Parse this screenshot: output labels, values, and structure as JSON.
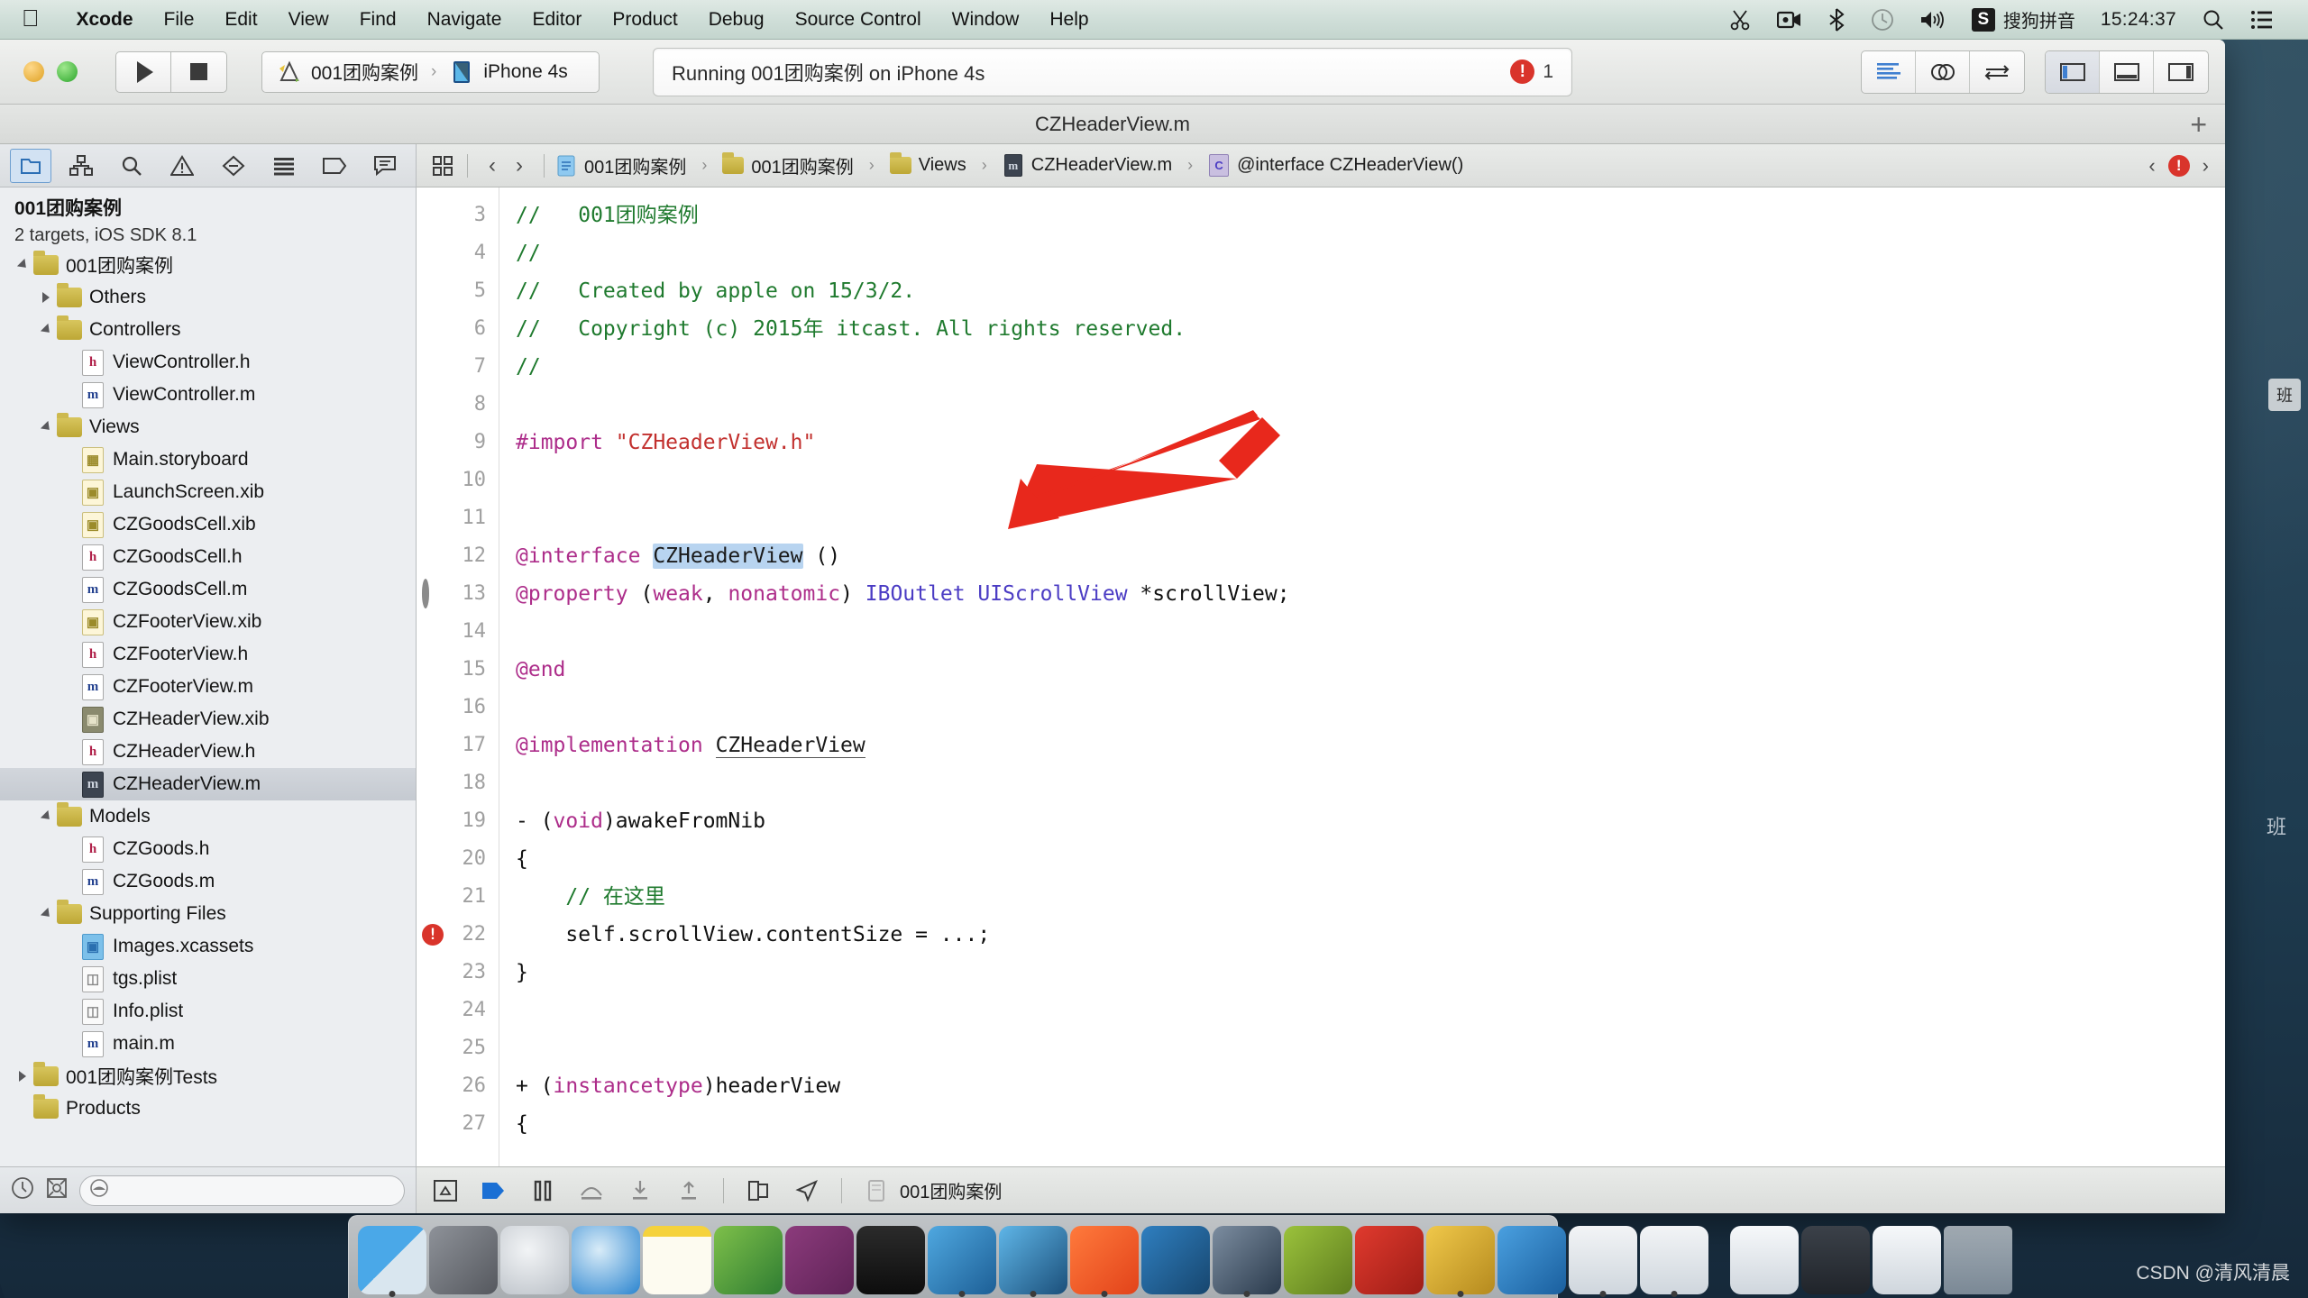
{
  "menubar": {
    "apple_icon": "apple-logo-icon",
    "items": [
      {
        "label": "Xcode",
        "bold": true
      },
      {
        "label": "File",
        "bold": false
      },
      {
        "label": "Edit",
        "bold": false
      },
      {
        "label": "View",
        "bold": false
      },
      {
        "label": "Find",
        "bold": false
      },
      {
        "label": "Navigate",
        "bold": false
      },
      {
        "label": "Editor",
        "bold": false
      },
      {
        "label": "Product",
        "bold": false
      },
      {
        "label": "Debug",
        "bold": false
      },
      {
        "label": "Source Control",
        "bold": false
      },
      {
        "label": "Window",
        "bold": false
      },
      {
        "label": "Help",
        "bold": false
      }
    ],
    "status": {
      "scissors_icon": "scissors-icon",
      "screen_record_icon": "screen-record-icon",
      "bluetooth_icon": "bluetooth-icon",
      "time_machine_icon": "time-machine-icon",
      "volume_icon": "volume-icon",
      "input_badge": "S",
      "input_name": "搜狗拼音",
      "clock": "15:24:37",
      "spotlight_icon": "search-icon",
      "notification_icon": "notification-center-icon"
    }
  },
  "toolbar": {
    "run_icon": "run-play-icon",
    "stop_icon": "stop-square-icon",
    "scheme_project": "001团购案例",
    "scheme_separator": "›",
    "scheme_destination": "iPhone 4s",
    "activity_status": "Running 001团购案例 on iPhone 4s",
    "issue_badge_icon": "error-icon",
    "issue_count": "1",
    "editor_modes": [
      {
        "name": "standard-editor",
        "icon": "lines-icon",
        "active": false
      },
      {
        "name": "assistant-editor",
        "icon": "venn-circles-icon",
        "active": false
      },
      {
        "name": "version-editor",
        "icon": "swap-arrows-icon",
        "active": false
      }
    ],
    "view_toggles": [
      {
        "name": "toggle-navigator",
        "icon": "left-panel-icon",
        "active": true
      },
      {
        "name": "toggle-debug-area",
        "icon": "bottom-panel-icon",
        "active": false
      },
      {
        "name": "toggle-utilities",
        "icon": "right-panel-icon",
        "active": false
      }
    ]
  },
  "window": {
    "title": "CZHeaderView.m",
    "add_tab_icon": "plus-icon"
  },
  "navigator": {
    "tabs": [
      {
        "name": "project-navigator",
        "icon": "folder-navigator-icon",
        "active": true
      },
      {
        "name": "symbol-navigator",
        "icon": "symbol-navigator-icon",
        "active": false
      },
      {
        "name": "find-navigator",
        "icon": "search-icon",
        "active": false
      },
      {
        "name": "issue-navigator",
        "icon": "warning-triangle-icon",
        "active": false
      },
      {
        "name": "test-navigator",
        "icon": "test-diamond-icon",
        "active": false
      },
      {
        "name": "debug-navigator",
        "icon": "debug-bars-icon",
        "active": false
      },
      {
        "name": "breakpoint-navigator",
        "icon": "breakpoint-tag-icon",
        "active": false
      },
      {
        "name": "report-navigator",
        "icon": "report-bubble-icon",
        "active": false
      }
    ],
    "project_name": "001团购案例",
    "project_subtitle": "2 targets, iOS SDK 8.1",
    "tree": [
      {
        "label": "001团购案例",
        "type": "folder",
        "indent": 0,
        "disclosure": "open",
        "selected": false
      },
      {
        "label": "Others",
        "type": "folder",
        "indent": 1,
        "disclosure": "closed",
        "selected": false
      },
      {
        "label": "Controllers",
        "type": "folder",
        "indent": 1,
        "disclosure": "open",
        "selected": false
      },
      {
        "label": "ViewController.h",
        "type": "h",
        "indent": 2,
        "disclosure": "none",
        "selected": false
      },
      {
        "label": "ViewController.m",
        "type": "m",
        "indent": 2,
        "disclosure": "none",
        "selected": false
      },
      {
        "label": "Views",
        "type": "folder",
        "indent": 1,
        "disclosure": "open",
        "selected": false
      },
      {
        "label": "Main.storyboard",
        "type": "sb",
        "indent": 2,
        "disclosure": "none",
        "selected": false
      },
      {
        "label": "LaunchScreen.xib",
        "type": "xib",
        "indent": 2,
        "disclosure": "none",
        "selected": false
      },
      {
        "label": "CZGoodsCell.xib",
        "type": "xib",
        "indent": 2,
        "disclosure": "none",
        "selected": false
      },
      {
        "label": "CZGoodsCell.h",
        "type": "h",
        "indent": 2,
        "disclosure": "none",
        "selected": false
      },
      {
        "label": "CZGoodsCell.m",
        "type": "m",
        "indent": 2,
        "disclosure": "none",
        "selected": false
      },
      {
        "label": "CZFooterView.xib",
        "type": "xib",
        "indent": 2,
        "disclosure": "none",
        "selected": false
      },
      {
        "label": "CZFooterView.h",
        "type": "h",
        "indent": 2,
        "disclosure": "none",
        "selected": false
      },
      {
        "label": "CZFooterView.m",
        "type": "m",
        "indent": 2,
        "disclosure": "none",
        "selected": false
      },
      {
        "label": "CZHeaderView.xib",
        "type": "xibdark",
        "indent": 2,
        "disclosure": "none",
        "selected": false
      },
      {
        "label": "CZHeaderView.h",
        "type": "h",
        "indent": 2,
        "disclosure": "none",
        "selected": false
      },
      {
        "label": "CZHeaderView.m",
        "type": "mdark",
        "indent": 2,
        "disclosure": "none",
        "selected": true
      },
      {
        "label": "Models",
        "type": "folder",
        "indent": 1,
        "disclosure": "open",
        "selected": false
      },
      {
        "label": "CZGoods.h",
        "type": "h",
        "indent": 2,
        "disclosure": "none",
        "selected": false
      },
      {
        "label": "CZGoods.m",
        "type": "m",
        "indent": 2,
        "disclosure": "none",
        "selected": false
      },
      {
        "label": "Supporting Files",
        "type": "folder",
        "indent": 1,
        "disclosure": "open",
        "selected": false
      },
      {
        "label": "Images.xcassets",
        "type": "xcassets",
        "indent": 2,
        "disclosure": "none",
        "selected": false
      },
      {
        "label": "tgs.plist",
        "type": "plist",
        "indent": 2,
        "disclosure": "none",
        "selected": false
      },
      {
        "label": "Info.plist",
        "type": "plist",
        "indent": 2,
        "disclosure": "none",
        "selected": false
      },
      {
        "label": "main.m",
        "type": "m",
        "indent": 2,
        "disclosure": "none",
        "selected": false
      },
      {
        "label": "001团购案例Tests",
        "type": "folder",
        "indent": 0,
        "disclosure": "closed",
        "selected": false
      },
      {
        "label": "Products",
        "type": "folder",
        "indent": 0,
        "disclosure": "none",
        "selected": false
      }
    ],
    "bottom": {
      "recent_icon": "clock-icon",
      "source_control_icon": "source-control-icon",
      "filter_icon": "filter-icon",
      "filter_placeholder": ""
    }
  },
  "jumpbar": {
    "related_icon": "related-items-icon",
    "back_icon": "chevron-left-icon",
    "forward_icon": "chevron-right-icon",
    "crumbs": [
      {
        "label": "001团购案例",
        "icon": "project-icon"
      },
      {
        "label": "001团购案例",
        "icon": "folder-icon"
      },
      {
        "label": "Views",
        "icon": "folder-icon"
      },
      {
        "label": "CZHeaderView.m",
        "icon": "m-file-icon"
      },
      {
        "label": "@interface CZHeaderView()",
        "icon": "interface-icon"
      }
    ],
    "prev_issue_icon": "chevron-left-icon",
    "issue_badge": "error-icon",
    "next_issue_icon": "chevron-right-icon"
  },
  "code": {
    "lines": [
      {
        "n": "3",
        "marker": "none",
        "tokens": [
          {
            "t": "//   001团购案例",
            "c": "cmt"
          }
        ]
      },
      {
        "n": "4",
        "marker": "none",
        "tokens": [
          {
            "t": "//",
            "c": "cmt"
          }
        ]
      },
      {
        "n": "5",
        "marker": "none",
        "tokens": [
          {
            "t": "//   Created by apple on 15/3/2.",
            "c": "cmt"
          }
        ]
      },
      {
        "n": "6",
        "marker": "none",
        "tokens": [
          {
            "t": "//   Copyright (c) 2015年 itcast. All rights reserved.",
            "c": "cmt"
          }
        ]
      },
      {
        "n": "7",
        "marker": "none",
        "tokens": [
          {
            "t": "//",
            "c": "cmt"
          }
        ]
      },
      {
        "n": "8",
        "marker": "none",
        "tokens": []
      },
      {
        "n": "9",
        "marker": "none",
        "tokens": [
          {
            "t": "#import ",
            "c": "pre"
          },
          {
            "t": "\"CZHeaderView.h\"",
            "c": "str"
          }
        ]
      },
      {
        "n": "10",
        "marker": "none",
        "tokens": []
      },
      {
        "n": "11",
        "marker": "none",
        "tokens": []
      },
      {
        "n": "12",
        "marker": "none",
        "tokens": [
          {
            "t": "@interface ",
            "c": "kw"
          },
          {
            "t": "CZHeaderView",
            "c": "sel"
          },
          {
            "t": " ()",
            "c": "id"
          }
        ]
      },
      {
        "n": "13",
        "marker": "dot",
        "tokens": [
          {
            "t": "@property ",
            "c": "kw"
          },
          {
            "t": "(",
            "c": "id"
          },
          {
            "t": "weak",
            "c": "kw"
          },
          {
            "t": ", ",
            "c": "id"
          },
          {
            "t": "nonatomic",
            "c": "kw"
          },
          {
            "t": ") ",
            "c": "id"
          },
          {
            "t": "IBOutlet ",
            "c": "typ"
          },
          {
            "t": "UIScrollView ",
            "c": "typ"
          },
          {
            "t": "*scrollView;",
            "c": "id"
          }
        ]
      },
      {
        "n": "14",
        "marker": "none",
        "tokens": []
      },
      {
        "n": "15",
        "marker": "none",
        "tokens": [
          {
            "t": "@end",
            "c": "kw"
          }
        ]
      },
      {
        "n": "16",
        "marker": "none",
        "tokens": []
      },
      {
        "n": "17",
        "marker": "none",
        "tokens": [
          {
            "t": "@implementation ",
            "c": "kw"
          },
          {
            "t": "CZHeaderView",
            "c": "under"
          }
        ]
      },
      {
        "n": "18",
        "marker": "none",
        "tokens": []
      },
      {
        "n": "19",
        "marker": "none",
        "tokens": [
          {
            "t": "- (",
            "c": "id"
          },
          {
            "t": "void",
            "c": "kw"
          },
          {
            "t": ")awakeFromNib",
            "c": "id"
          }
        ]
      },
      {
        "n": "20",
        "marker": "none",
        "tokens": [
          {
            "t": "{",
            "c": "id"
          }
        ]
      },
      {
        "n": "21",
        "marker": "none",
        "tokens": [
          {
            "t": "    // 在这里",
            "c": "cmt"
          }
        ]
      },
      {
        "n": "22",
        "marker": "error",
        "tokens": [
          {
            "t": "    self",
            "c": "id"
          },
          {
            "t": ".scrollView.contentSize = ...;",
            "c": "id"
          }
        ]
      },
      {
        "n": "23",
        "marker": "none",
        "tokens": [
          {
            "t": "}",
            "c": "id"
          }
        ]
      },
      {
        "n": "24",
        "marker": "none",
        "tokens": []
      },
      {
        "n": "25",
        "marker": "none",
        "tokens": []
      },
      {
        "n": "26",
        "marker": "none",
        "tokens": [
          {
            "t": "+ (",
            "c": "id"
          },
          {
            "t": "instancetype",
            "c": "kw"
          },
          {
            "t": ")headerView",
            "c": "id"
          }
        ]
      },
      {
        "n": "27",
        "marker": "none",
        "tokens": [
          {
            "t": "{",
            "c": "id"
          }
        ]
      }
    ]
  },
  "debugbar": {
    "hide_icon": "hide-debug-icon",
    "continue_icon": "continue-icon",
    "pause_icon": "pause-icon",
    "step_over_icon": "step-over-icon",
    "step_into_icon": "step-into-icon",
    "step_out_icon": "step-out-icon",
    "view_hierarchy_icon": "view-hierarchy-icon",
    "location_icon": "simulate-location-icon",
    "process_icon": "process-icon",
    "process_name": "001团购案例"
  },
  "dock": {
    "items": [
      {
        "name": "finder",
        "running": true
      },
      {
        "name": "system-preferences",
        "running": false
      },
      {
        "name": "launchpad",
        "running": false
      },
      {
        "name": "safari",
        "running": false
      },
      {
        "name": "notes",
        "running": false
      },
      {
        "name": "excel",
        "running": false
      },
      {
        "name": "onenote",
        "running": false
      },
      {
        "name": "terminal",
        "running": false
      },
      {
        "name": "xcode",
        "running": true
      },
      {
        "name": "simulator",
        "running": true
      },
      {
        "name": "qq",
        "running": true
      },
      {
        "name": "snipaste",
        "running": false
      },
      {
        "name": "quicktime",
        "running": true
      },
      {
        "name": "filezilla-alt",
        "running": false
      },
      {
        "name": "filezilla",
        "running": false
      },
      {
        "name": "photoshop",
        "running": true
      },
      {
        "name": "word",
        "running": false
      },
      {
        "name": "acrobat-a",
        "running": true
      },
      {
        "name": "acrobat-b",
        "running": true
      },
      {
        "name": "separator",
        "running": false
      },
      {
        "name": "downloads-1",
        "running": false
      },
      {
        "name": "downloads-2",
        "running": false
      },
      {
        "name": "downloads-3",
        "running": false
      },
      {
        "name": "trash",
        "running": false
      }
    ]
  },
  "desktop": {
    "right_chip": "班",
    "right_text": "班",
    "watermark": "CSDN @清风清晨"
  }
}
